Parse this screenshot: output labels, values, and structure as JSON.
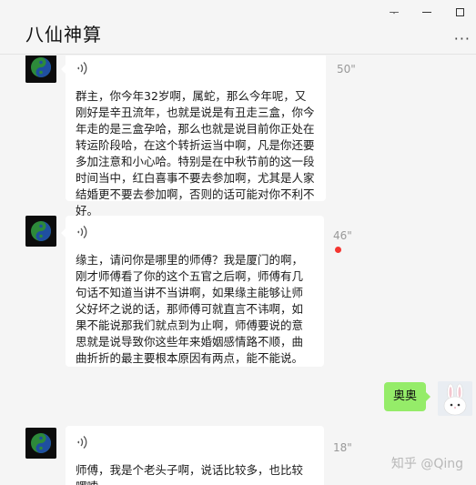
{
  "header": {
    "title": "八仙神算",
    "more_label": "···"
  },
  "window_controls": {
    "pin": "ᅮ",
    "minimize": "",
    "maximize": ""
  },
  "messages": [
    {
      "duration": "50\"",
      "text": "群主，你今年32岁啊，属蛇，那么今年呢，又刚好是辛丑流年，也就是说是有丑走三盒，你今年走的是三盒孕哈，那么也就是说目前你正处在转运阶段哈，在这个转折运当中啊，凡是你还要多加注意和小心哈。特别是在中秋节前的这一段时间当中，红白喜事不要去参加啊，尤其是人家结婚更不要去参加啊，否则的话可能对你不利不好。"
    },
    {
      "duration": "46\"",
      "text": "缘主，请问你是哪里的师傅？我是厦门的啊，刚才师傅看了你的这个五官之后啊，师傅有几句话不知道当讲不当讲啊，如果缘主能够让师父好坏之说的话，那师傅可就直言不讳啊，如果不能说那我们就点到为止啊，师傅要说的意思就是说导致你这些年来婚姻感情路不顺，曲曲折折的最主要根本原因有两点，能不能说。"
    },
    {
      "reply": "奥奥"
    },
    {
      "duration": "18\"",
      "text": "师傅，我是个老头子啊，说话比较多，也比较啰嗦"
    }
  ],
  "watermark": "知乎 @Qing",
  "colors": {
    "background": "#f5f5f5",
    "bubble_left": "#ffffff",
    "bubble_right": "#95ec69",
    "unread_dot": "#f43530"
  }
}
